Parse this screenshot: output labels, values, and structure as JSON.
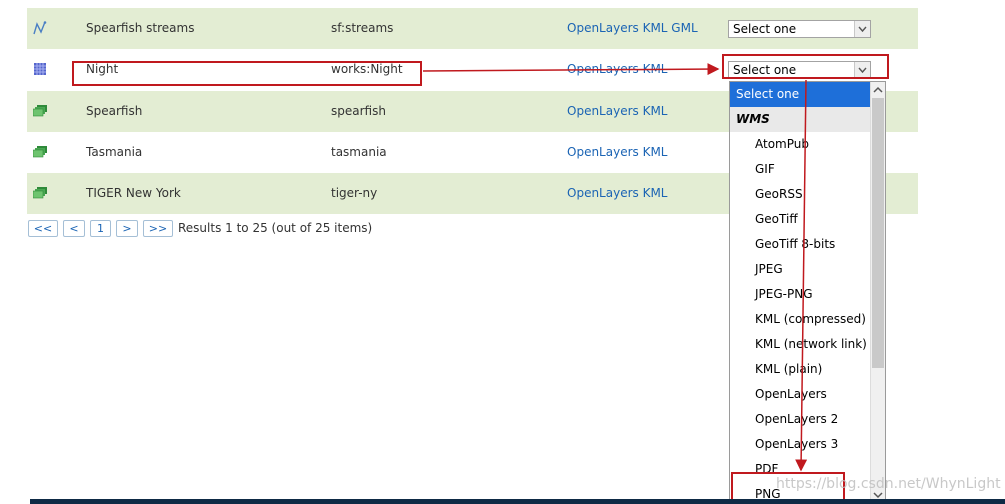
{
  "colors": {
    "row_odd": "#e3edd3",
    "link": "#1b64b4",
    "selected_option": "#1e6fd9",
    "annotation": "#c0191e"
  },
  "rows": [
    {
      "icon": "line-layer-icon",
      "title": "Spearfish streams",
      "name": "sf:streams",
      "links": "OpenLayers KML GML",
      "select": "Select one"
    },
    {
      "icon": "raster-layer-icon",
      "title": "Night",
      "name": "works:Night",
      "links": "OpenLayers KML",
      "select": "Select one"
    },
    {
      "icon": "group-layer-icon",
      "title": "Spearfish",
      "name": "spearfish",
      "links": "OpenLayers KML",
      "select": ""
    },
    {
      "icon": "group-layer-icon",
      "title": "Tasmania",
      "name": "tasmania",
      "links": "OpenLayers KML",
      "select": ""
    },
    {
      "icon": "group-layer-icon",
      "title": "TIGER New York",
      "name": "tiger-ny",
      "links": "OpenLayers KML",
      "select": ""
    }
  ],
  "pager": {
    "first": "<<",
    "prev": "<",
    "page": "1",
    "next": ">",
    "last": ">>",
    "results": "Results 1 to 25 (out of 25 items)"
  },
  "dropdown": {
    "selected": "Select one",
    "group": "WMS",
    "options": [
      "AtomPub",
      "GIF",
      "GeoRSS",
      "GeoTiff",
      "GeoTiff 8-bits",
      "JPEG",
      "JPEG-PNG",
      "KML (compressed)",
      "KML (network link)",
      "KML (plain)",
      "OpenLayers",
      "OpenLayers 2",
      "OpenLayers 3",
      "PDF",
      "PNG"
    ]
  },
  "watermark": "https://blog.csdn.net/WhynLight"
}
